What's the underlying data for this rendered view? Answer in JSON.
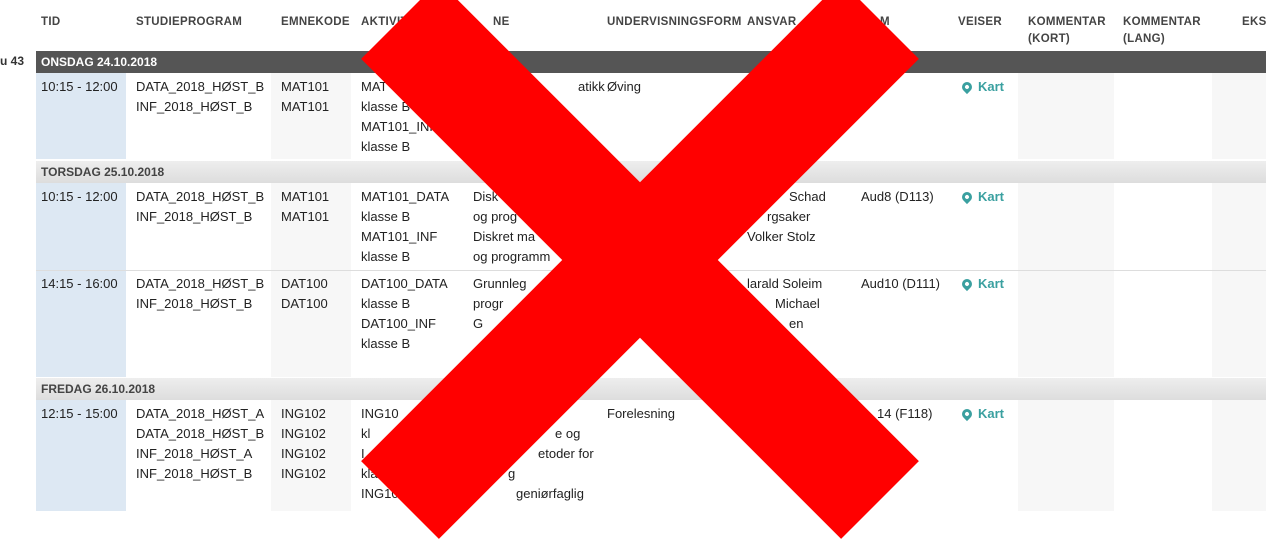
{
  "headers": {
    "tid": "TID",
    "studieprogram": "STUDIEPROGRAM",
    "emnekode": "EMNEKODE",
    "aktivitet": "AKTIVIT",
    "emnenavn": "NE",
    "undervisningsform": "UNDERVISNINGSFORM",
    "ansvarlig": "ANSVAR",
    "rom": "M",
    "veiviser": "VEISER",
    "kommentar_kort": "KOMMENTAR (KORT)",
    "kommentar_lang": "KOMMENTAR (LANG)",
    "eksamen": "EKSA"
  },
  "week_label": "u 43",
  "kart_label": "Kart",
  "days": [
    {
      "label": "ONSDAG 24.10.2018",
      "rows": [
        {
          "time": "10:15 - 12:00",
          "programs": [
            "DATA_2018_HØST_B",
            "INF_2018_HØST_B"
          ],
          "codes": [
            "MAT101",
            "MAT101"
          ],
          "activity": [
            "MAT",
            "klasse B",
            "MAT101_INF",
            "klasse B"
          ],
          "course": [
            "atikk"
          ],
          "form": "Øving",
          "responsible": [],
          "room": ""
        }
      ]
    },
    {
      "label": "TORSDAG 25.10.2018",
      "rows": [
        {
          "time": "10:15 - 12:00",
          "programs": [
            "DATA_2018_HØST_B",
            "INF_2018_HØST_B"
          ],
          "codes": [
            "MAT101",
            "MAT101"
          ],
          "activity": [
            "MAT101_DATA",
            "klasse B",
            "MAT101_INF",
            "klasse B"
          ],
          "course": [
            "Disk",
            "og prog",
            "Diskret ma",
            "og programm"
          ],
          "form": "",
          "responsible": [
            "Schad",
            "rgsaker",
            "Volker Stolz"
          ],
          "room": "Aud8 (D113)"
        },
        {
          "time": "14:15 - 16:00",
          "programs": [
            "DATA_2018_HØST_B",
            "INF_2018_HØST_B"
          ],
          "codes": [
            "DAT100",
            "DAT100"
          ],
          "activity": [
            "DAT100_DATA",
            "klasse B",
            "DAT100_INF",
            "klasse B"
          ],
          "course": [
            "Grunnleg",
            "progr",
            "G"
          ],
          "form": "",
          "responsible": [
            "larald Soleim",
            "Michael",
            "en"
          ],
          "room": "Aud10 (D111)"
        }
      ]
    },
    {
      "label": "FREDAG 26.10.2018",
      "rows": [
        {
          "time": "12:15 - 15:00",
          "programs": [
            "DATA_2018_HØST_A",
            "DATA_2018_HØST_B",
            "INF_2018_HØST_A",
            "INF_2018_HØST_B"
          ],
          "codes": [
            "ING102",
            "ING102",
            "ING102",
            "ING102"
          ],
          "activity": [
            "ING10",
            "kl",
            "I",
            "klas",
            "ING102_"
          ],
          "course": [
            "e og",
            "etoder for",
            "g",
            "geniørfaglig"
          ],
          "form": "Forelesning",
          "responsible": [],
          "room": "14 (F118)"
        }
      ]
    }
  ]
}
